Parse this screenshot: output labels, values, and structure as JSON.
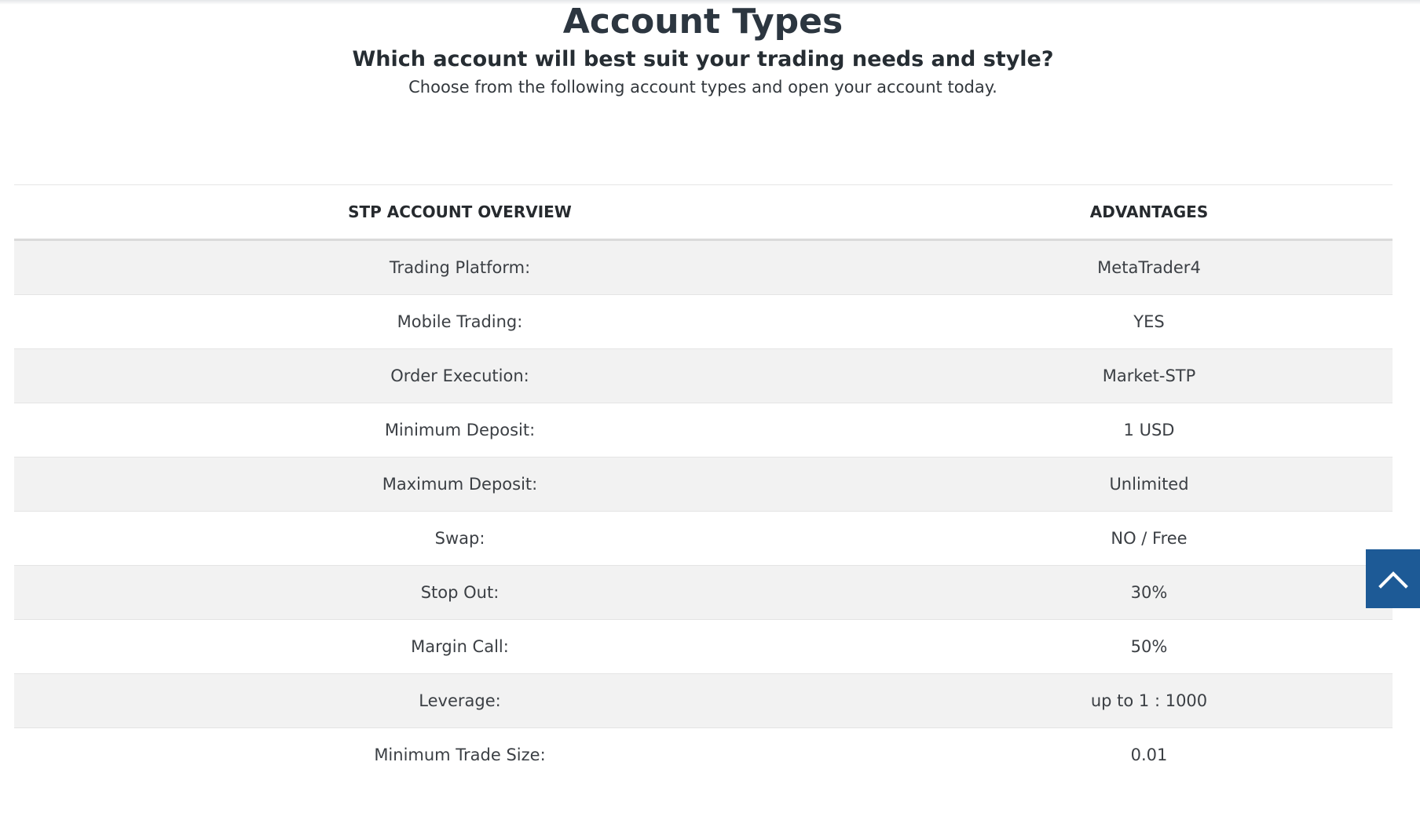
{
  "header": {
    "title": "Account Types",
    "subtitle": "Which account will best suit your trading needs and style?",
    "intro": "Choose from the following account types and open your account today."
  },
  "table": {
    "columns": [
      "STP ACCOUNT OVERVIEW",
      "ADVANTAGES"
    ],
    "rows": [
      {
        "label": "Trading Platform:",
        "value": "MetaTrader4"
      },
      {
        "label": "Mobile Trading:",
        "value": "YES"
      },
      {
        "label": "Order Execution:",
        "value": "Market-STP"
      },
      {
        "label": "Minimum Deposit:",
        "value": "1 USD"
      },
      {
        "label": "Maximum Deposit:",
        "value": "Unlimited"
      },
      {
        "label": "Swap:",
        "value": "NO / Free"
      },
      {
        "label": "Stop Out:",
        "value": "30%"
      },
      {
        "label": "Margin Call:",
        "value": "50%"
      },
      {
        "label": "Leverage:",
        "value": "up to 1 : 1000"
      },
      {
        "label": "Minimum Trade Size:",
        "value": "0.01"
      }
    ]
  },
  "scroll_top": {
    "icon": "chevron-up-icon",
    "color": "#1d5a96"
  }
}
